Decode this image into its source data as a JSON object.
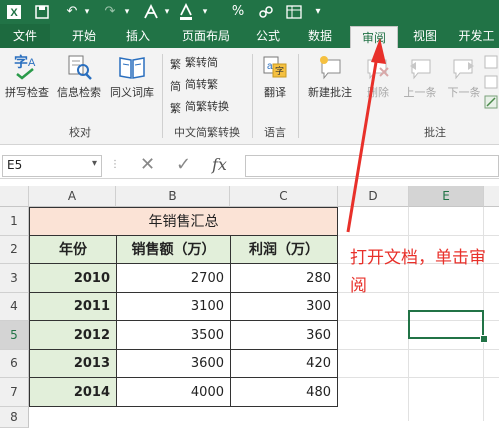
{
  "qat": {
    "undo": "↶",
    "redo": "↷",
    "percent": "%"
  },
  "tabs": [
    "文件",
    "开始",
    "插入",
    "页面布局",
    "公式",
    "数据",
    "审阅",
    "视图",
    "开发工"
  ],
  "ribbon": {
    "spelling": "拼写检查",
    "research": "信息检索",
    "thesaurus": "同义词库",
    "group1": "校对",
    "to_trad": "繁转简",
    "to_simp": "简转繁",
    "convert": "简繁转换",
    "group2": "中文简繁转换",
    "translate": "翻译",
    "group3": "语言",
    "new_comment": "新建批注",
    "delete": "删除",
    "prev": "上一条",
    "next": "下一条",
    "group4": "批注"
  },
  "formula_bar": {
    "namebox": "E5",
    "fx": "fx",
    "value": ""
  },
  "columns": [
    "A",
    "B",
    "C",
    "D",
    "E"
  ],
  "rows": [
    "1",
    "2",
    "3",
    "4",
    "5",
    "6",
    "7",
    "8"
  ],
  "sheet": {
    "title": "年销售汇总",
    "headers": [
      "年份",
      "销售额（万）",
      "利润（万）"
    ],
    "data": [
      [
        "2010",
        "2700",
        "280"
      ],
      [
        "2011",
        "3100",
        "300"
      ],
      [
        "2012",
        "3500",
        "360"
      ],
      [
        "2013",
        "3600",
        "420"
      ],
      [
        "2014",
        "4000",
        "480"
      ]
    ]
  },
  "annotation": "打开文档，单击审阅",
  "colors": {
    "excel_green": "#217346",
    "title_fill": "#fbe3d6",
    "header_fill": "#e2efda",
    "red": "#e8302a"
  }
}
